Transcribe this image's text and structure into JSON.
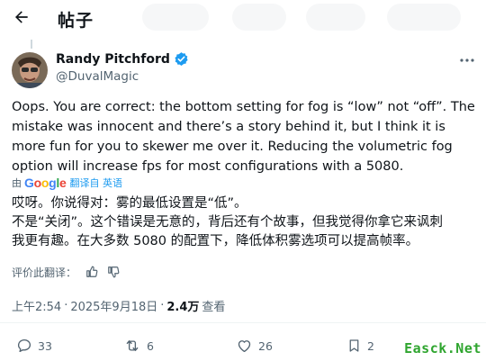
{
  "header": {
    "title": "帖子",
    "back_icon": "arrow-left-icon"
  },
  "author": {
    "display_name": "Randy Pitchford",
    "handle": "@DuvalMagic",
    "verified": true,
    "verified_color": "#1d9bf0"
  },
  "tweet": {
    "text": "Oops. You are correct: the bottom setting for fog is “low” not “off”. The mistake was innocent and there’s a story behind it, but I think it is more fun for you to skewer me over it. Reducing the volumetric fog option will increase fps for most configurations with a 5080."
  },
  "translation": {
    "by_label": "由",
    "provider": "Google",
    "link_text": "翻译自 英语",
    "lines": [
      "哎呀。你说得对：雾的最低设置是“低”。",
      "不是“关闭”。这个错误是无意的，背后还有个故事，但我觉得你拿它来讽刺",
      "我更有趣。在大多数 5080 的配置下，降低体积雾选项可以提高帧率。"
    ],
    "rate_label": "评价此翻译：",
    "rate_icons": [
      "thumbs-up-icon",
      "thumbs-down-icon"
    ]
  },
  "meta": {
    "time": "上午2:54",
    "date": "2025年9月18日",
    "views_count": "2.4万",
    "views_label": "查看",
    "separator": "·"
  },
  "actions": {
    "replies": "33",
    "reposts": "6",
    "likes": "26",
    "bookmarks": "2"
  },
  "watermark": "Easck.Net",
  "colors": {
    "accent": "#1d9bf0",
    "muted": "#536471",
    "text": "#0f1419",
    "watermark": "#2fa52f"
  }
}
